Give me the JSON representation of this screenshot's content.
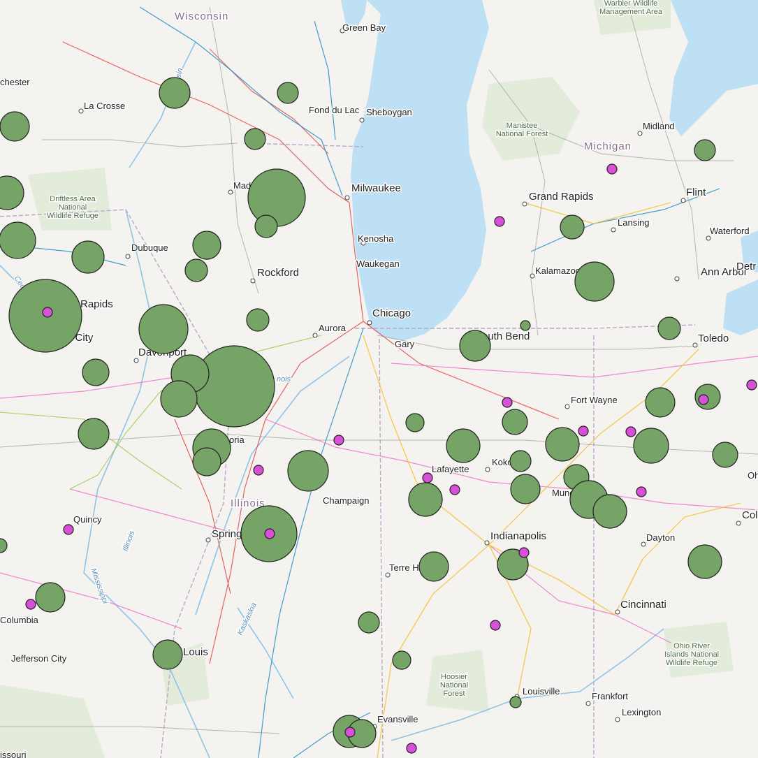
{
  "map": {
    "colors": {
      "land": "#f4f3ef",
      "water": "#bde0f5",
      "forest": "#dfe9d5",
      "bubble_fill": "#76a366",
      "dot_fill": "#d84fd8",
      "outline": "#222222"
    },
    "region_labels": [
      {
        "id": "wisconsin",
        "text": "Wisconsin"
      },
      {
        "id": "michigan",
        "text": "Michigan"
      },
      {
        "id": "illinois",
        "text": "Illinois"
      }
    ],
    "city_labels": [
      {
        "id": "green-bay",
        "text": "Green Bay"
      },
      {
        "id": "la-crosse",
        "text": "La Crosse"
      },
      {
        "id": "rochester",
        "text": "chester"
      },
      {
        "id": "fond-du-lac",
        "text": "Fond du Lac"
      },
      {
        "id": "sheboygan",
        "text": "Sheboygan"
      },
      {
        "id": "madison",
        "text": "Mad"
      },
      {
        "id": "milwaukee",
        "text": "Milwaukee"
      },
      {
        "id": "kenosha",
        "text": "Kenosha"
      },
      {
        "id": "waukegan",
        "text": "Waukegan"
      },
      {
        "id": "dubuque",
        "text": "Dubuque"
      },
      {
        "id": "rockford",
        "text": "Rockford"
      },
      {
        "id": "cedar-rapids",
        "text": "Rapids"
      },
      {
        "id": "chicago",
        "text": "Chicago"
      },
      {
        "id": "aurora",
        "text": "Aurora"
      },
      {
        "id": "iowa-city",
        "text": "a City"
      },
      {
        "id": "davenport",
        "text": "Davenport"
      },
      {
        "id": "gary",
        "text": "Gary"
      },
      {
        "id": "south-bend",
        "text": "outh Bend"
      },
      {
        "id": "midland",
        "text": "Midland"
      },
      {
        "id": "grand-rapids",
        "text": "Grand Rapids"
      },
      {
        "id": "flint",
        "text": "Flint"
      },
      {
        "id": "lansing",
        "text": "Lansing"
      },
      {
        "id": "waterford",
        "text": "Waterford"
      },
      {
        "id": "kalamazoo",
        "text": "Kalamazoo"
      },
      {
        "id": "ann-arbor",
        "text": "Ann Arbor"
      },
      {
        "id": "detroit",
        "text": "Detr"
      },
      {
        "id": "toledo",
        "text": "Toledo"
      },
      {
        "id": "fort-wayne",
        "text": "Fort Wayne"
      },
      {
        "id": "peoria",
        "text": "oria"
      },
      {
        "id": "lafayette",
        "text": "Lafayette"
      },
      {
        "id": "kokomo",
        "text": "Koko"
      },
      {
        "id": "champaign",
        "text": "Champaign"
      },
      {
        "id": "muncie",
        "text": "Munc"
      },
      {
        "id": "quincy",
        "text": "Quincy"
      },
      {
        "id": "springfield",
        "text": "Spring"
      },
      {
        "id": "indianapolis",
        "text": "Indianapolis"
      },
      {
        "id": "dayton",
        "text": "Dayton"
      },
      {
        "id": "columbus",
        "text": "Col"
      },
      {
        "id": "ohio",
        "text": "Oh"
      },
      {
        "id": "terre-haute",
        "text": "Terre H"
      },
      {
        "id": "cincinnati",
        "text": "Cincinnati"
      },
      {
        "id": "columbia",
        "text": "Columbia"
      },
      {
        "id": "jefferson-city",
        "text": "Jefferson City"
      },
      {
        "id": "st-louis",
        "text": "Louis"
      },
      {
        "id": "louisville",
        "text": "Louisville"
      },
      {
        "id": "frankfort",
        "text": "Frankfort"
      },
      {
        "id": "lexington",
        "text": "Lexington"
      },
      {
        "id": "evansville",
        "text": "Evansville"
      },
      {
        "id": "missouri",
        "text": "issouri"
      }
    ],
    "park_labels": [
      {
        "id": "warbler",
        "lines": [
          "Warbler Wildlife",
          "Management Area"
        ]
      },
      {
        "id": "manistee",
        "lines": [
          "Manistee",
          "National Forest"
        ]
      },
      {
        "id": "driftless",
        "lines": [
          "Driftless Area",
          "National",
          "Wildlife Refuge"
        ]
      },
      {
        "id": "hoosier",
        "lines": [
          "Hoosier",
          "National",
          "Forest"
        ]
      },
      {
        "id": "ohio-river",
        "lines": [
          "Ohio River",
          "Islands National",
          "Wildlife Refuge"
        ]
      }
    ],
    "river_labels": [
      {
        "id": "wisconsin-river",
        "text": "sin"
      },
      {
        "id": "cedar-river",
        "text": "Cedar"
      },
      {
        "id": "illinois-river",
        "text": "Illinois"
      },
      {
        "id": "mississippi-river",
        "text": "Mississippi"
      },
      {
        "id": "kaskaskia-river",
        "text": "Kaskaskia"
      },
      {
        "id": "illinois-canal",
        "text": "nois"
      }
    ]
  }
}
